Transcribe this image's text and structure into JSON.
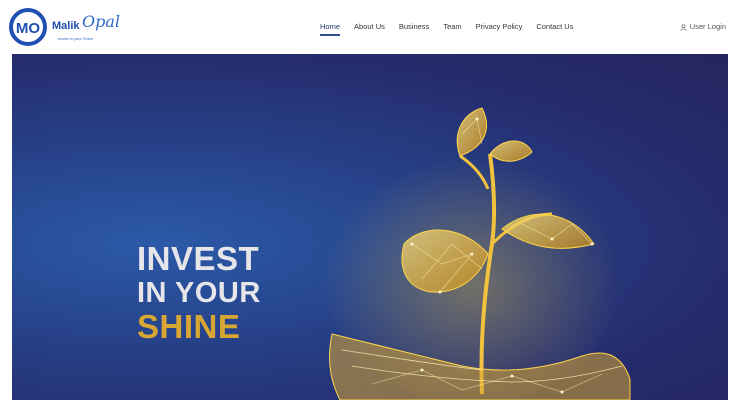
{
  "brand": {
    "mark": "MO",
    "word1": "Malik",
    "word2": "Opal",
    "tagline": "Invest in your Shine"
  },
  "nav": {
    "items": [
      {
        "label": "Home",
        "active": true
      },
      {
        "label": "About Us"
      },
      {
        "label": "Business"
      },
      {
        "label": "Team"
      },
      {
        "label": "Privacy Policy"
      },
      {
        "label": "Contact Us"
      }
    ]
  },
  "login": {
    "label": "User Login",
    "icon": "user-icon"
  },
  "hero": {
    "line1": "INVEST",
    "line2": "IN YOUR",
    "line3": "SHINE",
    "image": "golden-sprout-in-hands-illustration"
  },
  "colors": {
    "accent": "#d8a632",
    "hero_bg": "#263f86",
    "nav_active": "#1e3a6e"
  }
}
